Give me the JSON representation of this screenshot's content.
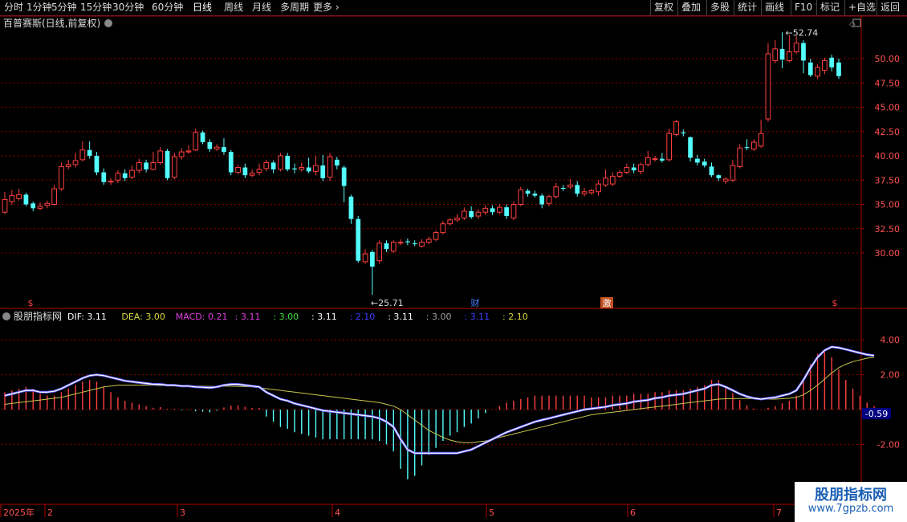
{
  "toolbar": {
    "periods": [
      "分时",
      "1分钟",
      "5分钟",
      "15分钟",
      "30分钟",
      "60分钟",
      "日线",
      "周线",
      "月线",
      "多周期",
      "更多"
    ],
    "active_period": "日线",
    "right_buttons": [
      "复权",
      "叠加",
      "多股",
      "统计",
      "画线",
      "F10",
      "标记",
      "+自选",
      "返回"
    ]
  },
  "colors": {
    "up": "#ff4040",
    "down": "#54ffff",
    "dif": "#ffffff",
    "dea": "#c8c84c",
    "macd_pos": "#ff4040",
    "macd_neg": "#54ffff",
    "axis": "#b00000",
    "grid": "#8b0000"
  },
  "watermark": {
    "title": "股朋指标网",
    "url": "www.7gpzb.com"
  },
  "chart_data": [
    {
      "type": "candlestick",
      "title": "百普赛斯(日线,前复权)",
      "yticks": [
        30.0,
        32.5,
        35.0,
        37.5,
        40.0,
        42.5,
        45.0,
        47.5,
        50.0
      ],
      "ylim": [
        26.8,
        55.0
      ],
      "annotations": {
        "high": "52.74",
        "low": "25.71",
        "events": [
          "$",
          "财",
          "激",
          "$"
        ]
      },
      "x_labels": [
        "2025年",
        "2",
        "3",
        "4",
        "5",
        "6",
        "7"
      ],
      "candles": [
        [
          34.2,
          35.5,
          36.3,
          34.0
        ],
        [
          35.3,
          35.9,
          36.5,
          35.0
        ],
        [
          35.6,
          36.0,
          36.6,
          35.4
        ],
        [
          36.0,
          35.0,
          36.2,
          34.8
        ],
        [
          35.1,
          34.6,
          35.3,
          34.3
        ],
        [
          34.6,
          34.8,
          35.2,
          34.4
        ],
        [
          34.9,
          35.1,
          35.4,
          34.6
        ],
        [
          35.0,
          36.6,
          37.0,
          34.9
        ],
        [
          36.6,
          38.9,
          39.3,
          36.4
        ],
        [
          38.9,
          39.1,
          39.6,
          38.6
        ],
        [
          39.1,
          39.5,
          40.3,
          38.8
        ],
        [
          39.6,
          40.6,
          41.5,
          39.4
        ],
        [
          40.6,
          40.0,
          41.5,
          39.7
        ],
        [
          40.0,
          38.3,
          40.4,
          38.0
        ],
        [
          38.3,
          37.3,
          38.7,
          37.0
        ],
        [
          37.3,
          37.4,
          37.7,
          37.0
        ],
        [
          37.5,
          38.2,
          38.5,
          37.2
        ],
        [
          38.2,
          37.7,
          38.6,
          37.4
        ],
        [
          37.8,
          38.5,
          39.0,
          37.6
        ],
        [
          38.5,
          39.3,
          39.7,
          38.2
        ],
        [
          39.3,
          38.6,
          39.6,
          38.3
        ],
        [
          38.6,
          39.3,
          40.4,
          38.5
        ],
        [
          39.3,
          40.5,
          40.9,
          39.1
        ],
        [
          40.5,
          37.7,
          40.7,
          37.5
        ],
        [
          37.8,
          39.9,
          40.3,
          37.6
        ],
        [
          39.9,
          40.4,
          40.8,
          39.6
        ],
        [
          40.4,
          40.5,
          41.1,
          40.2
        ],
        [
          40.6,
          42.4,
          42.8,
          40.5
        ],
        [
          42.4,
          41.4,
          42.6,
          41.2
        ],
        [
          41.4,
          40.7,
          41.7,
          40.4
        ],
        [
          40.7,
          40.9,
          41.2,
          40.5
        ],
        [
          40.9,
          40.4,
          41.8,
          40.1
        ],
        [
          40.4,
          38.3,
          40.6,
          38.0
        ],
        [
          38.3,
          38.8,
          39.1,
          38.1
        ],
        [
          38.8,
          38.0,
          39.2,
          37.7
        ],
        [
          38.0,
          38.2,
          38.6,
          37.8
        ],
        [
          38.3,
          38.6,
          39.2,
          38.0
        ],
        [
          38.7,
          39.3,
          39.6,
          38.4
        ],
        [
          39.3,
          38.6,
          39.5,
          38.2
        ],
        [
          38.6,
          40.0,
          40.3,
          38.4
        ],
        [
          40.0,
          38.6,
          40.3,
          38.4
        ],
        [
          38.7,
          38.6,
          39.2,
          38.2
        ],
        [
          38.6,
          38.8,
          39.3,
          38.4
        ],
        [
          38.8,
          38.4,
          39.8,
          38.2
        ],
        [
          38.4,
          39.0,
          40.0,
          38.0
        ],
        [
          39.0,
          37.7,
          40.1,
          37.4
        ],
        [
          37.8,
          39.9,
          40.3,
          37.4
        ],
        [
          39.6,
          39.0,
          39.9,
          38.6
        ],
        [
          38.8,
          36.9,
          39.0,
          35.2
        ],
        [
          35.8,
          33.5,
          36.0,
          33.0
        ],
        [
          33.5,
          29.2,
          33.8,
          29.0
        ],
        [
          29.1,
          29.9,
          30.4,
          28.9
        ],
        [
          30.1,
          28.6,
          30.3,
          25.7
        ],
        [
          29.2,
          31.0,
          31.3,
          28.9
        ],
        [
          31.0,
          30.4,
          31.3,
          30.1
        ],
        [
          30.2,
          31.1,
          31.3,
          30.0
        ],
        [
          31.1,
          31.1,
          31.4,
          30.8
        ],
        [
          31.2,
          31.1,
          31.5,
          30.8
        ],
        [
          31.0,
          30.9,
          31.3,
          30.7
        ],
        [
          30.7,
          31.1,
          31.4,
          30.6
        ],
        [
          31.1,
          31.4,
          31.7,
          30.9
        ],
        [
          31.4,
          32.1,
          32.3,
          31.2
        ],
        [
          32.1,
          33.0,
          33.3,
          31.9
        ],
        [
          33.0,
          33.4,
          33.6,
          32.8
        ],
        [
          33.4,
          33.6,
          34.0,
          33.2
        ],
        [
          33.6,
          34.3,
          34.7,
          33.4
        ],
        [
          34.3,
          33.7,
          34.8,
          33.5
        ],
        [
          33.8,
          34.2,
          34.5,
          33.5
        ],
        [
          34.2,
          34.6,
          34.9,
          33.9
        ],
        [
          34.6,
          34.2,
          34.9,
          33.9
        ],
        [
          34.2,
          34.7,
          35.0,
          34.0
        ],
        [
          34.7,
          33.8,
          35.0,
          33.5
        ],
        [
          33.6,
          35.0,
          35.3,
          33.4
        ],
        [
          35.0,
          36.5,
          36.8,
          34.8
        ],
        [
          36.4,
          36.1,
          36.6,
          35.8
        ],
        [
          36.1,
          35.9,
          36.4,
          35.7
        ],
        [
          35.9,
          35.0,
          36.1,
          34.6
        ],
        [
          35.1,
          35.8,
          36.0,
          34.8
        ],
        [
          35.8,
          36.8,
          37.2,
          35.6
        ],
        [
          36.7,
          36.6,
          37.0,
          36.4
        ],
        [
          36.8,
          37.0,
          37.6,
          36.6
        ],
        [
          37.0,
          36.1,
          37.4,
          35.8
        ],
        [
          36.1,
          36.3,
          36.7,
          35.8
        ],
        [
          36.2,
          36.4,
          36.6,
          36.0
        ],
        [
          36.3,
          37.1,
          37.5,
          35.9
        ],
        [
          37.0,
          37.7,
          38.6,
          36.8
        ],
        [
          37.1,
          37.9,
          38.3,
          36.9
        ],
        [
          37.9,
          38.3,
          38.5,
          37.7
        ],
        [
          38.3,
          38.8,
          39.2,
          38.1
        ],
        [
          38.8,
          38.5,
          39.2,
          38.2
        ],
        [
          38.4,
          39.1,
          39.3,
          38.1
        ],
        [
          39.1,
          39.8,
          40.5,
          38.9
        ],
        [
          39.7,
          39.7,
          40.0,
          39.4
        ],
        [
          39.7,
          39.5,
          40.3,
          39.3
        ],
        [
          39.6,
          42.3,
          42.8,
          39.4
        ],
        [
          42.2,
          43.5,
          43.7,
          42.0
        ],
        [
          42.4,
          42.3,
          42.7,
          42.0
        ],
        [
          41.9,
          39.8,
          42.0,
          39.4
        ],
        [
          39.7,
          39.3,
          40.1,
          39.0
        ],
        [
          39.4,
          39.0,
          39.7,
          38.8
        ],
        [
          38.9,
          38.0,
          39.3,
          37.8
        ],
        [
          38.0,
          37.7,
          38.1,
          37.4
        ],
        [
          37.4,
          37.6,
          37.8,
          37.1
        ],
        [
          37.5,
          39.0,
          39.6,
          37.3
        ],
        [
          38.9,
          40.8,
          41.2,
          38.7
        ],
        [
          40.9,
          40.8,
          41.7,
          40.6
        ],
        [
          40.7,
          41.4,
          41.7,
          40.5
        ],
        [
          41.0,
          42.3,
          43.7,
          40.8
        ],
        [
          43.8,
          50.5,
          51.6,
          43.5
        ],
        [
          49.8,
          51.0,
          51.9,
          49.5
        ],
        [
          51.0,
          49.9,
          52.7,
          49.0
        ],
        [
          49.8,
          50.7,
          52.4,
          49.6
        ],
        [
          50.7,
          51.6,
          52.3,
          50.5
        ],
        [
          51.6,
          49.8,
          51.9,
          48.5
        ],
        [
          49.6,
          48.3,
          50.0,
          48.1
        ],
        [
          48.2,
          49.1,
          49.4,
          47.9
        ],
        [
          48.8,
          49.8,
          50.1,
          48.4
        ],
        [
          50.1,
          49.1,
          50.4,
          48.7
        ],
        [
          49.6,
          48.2,
          50.0,
          47.9
        ]
      ]
    },
    {
      "type": "line+bar",
      "title": "股朋指标网",
      "legend": [
        {
          "label": "DIF: 3.11",
          "color": "#ffffff"
        },
        {
          "label": "DEA: 3.00",
          "color": "#d8d83c"
        },
        {
          "label": "MACD: 0.21",
          "color": "#e040e0"
        },
        {
          "label": ": 3.11",
          "color": "#e040e0"
        },
        {
          "label": ": 3.00",
          "color": "#40e040"
        },
        {
          "label": ": 3.11",
          "color": "#ffffff"
        },
        {
          "label": ": 2.10",
          "color": "#4040ff"
        },
        {
          "label": ": 3.11",
          "color": "#ffffff"
        },
        {
          "label": ": 3.00",
          "color": "#a0a0a0"
        },
        {
          "label": ": 3.11",
          "color": "#4040ff"
        },
        {
          "label": ": 2.10",
          "color": "#d8d83c"
        }
      ],
      "yticks": [
        4.0,
        2.0,
        -2.0
      ],
      "ylim": [
        -5.5,
        5.5
      ],
      "current_value": "0.59",
      "dif": [
        0.8,
        0.9,
        1.0,
        1.1,
        1.1,
        1.0,
        1.0,
        1.05,
        1.2,
        1.4,
        1.6,
        1.8,
        1.95,
        2.0,
        1.95,
        1.85,
        1.75,
        1.65,
        1.6,
        1.55,
        1.5,
        1.45,
        1.45,
        1.4,
        1.4,
        1.35,
        1.35,
        1.3,
        1.28,
        1.25,
        1.3,
        1.4,
        1.45,
        1.45,
        1.4,
        1.35,
        1.3,
        1.0,
        0.8,
        0.6,
        0.5,
        0.35,
        0.25,
        0.15,
        0.05,
        -0.05,
        -0.1,
        -0.15,
        -0.2,
        -0.25,
        -0.3,
        -0.35,
        -0.4,
        -0.5,
        -0.7,
        -1.0,
        -1.7,
        -2.3,
        -2.5,
        -2.5,
        -2.5,
        -2.5,
        -2.5,
        -2.5,
        -2.5,
        -2.4,
        -2.3,
        -2.1,
        -1.9,
        -1.7,
        -1.5,
        -1.3,
        -1.15,
        -1.0,
        -0.85,
        -0.7,
        -0.6,
        -0.5,
        -0.4,
        -0.3,
        -0.2,
        -0.1,
        0.0,
        0.05,
        0.1,
        0.15,
        0.25,
        0.3,
        0.35,
        0.45,
        0.5,
        0.55,
        0.65,
        0.7,
        0.8,
        0.85,
        0.9,
        1.0,
        1.1,
        1.2,
        1.4,
        1.45,
        1.3,
        1.1,
        0.9,
        0.75,
        0.65,
        0.6,
        0.65,
        0.7,
        0.8,
        0.9,
        1.1,
        1.7,
        2.4,
        3.0,
        3.4,
        3.6,
        3.55,
        3.45,
        3.35,
        3.25,
        3.15,
        3.1
      ],
      "dea": [
        0.3,
        0.35,
        0.4,
        0.45,
        0.5,
        0.55,
        0.6,
        0.65,
        0.7,
        0.8,
        0.9,
        1.0,
        1.1,
        1.2,
        1.3,
        1.35,
        1.4,
        1.4,
        1.4,
        1.4,
        1.4,
        1.4,
        1.38,
        1.38,
        1.38,
        1.37,
        1.36,
        1.35,
        1.34,
        1.33,
        1.33,
        1.34,
        1.34,
        1.33,
        1.32,
        1.3,
        1.25,
        1.2,
        1.15,
        1.1,
        1.05,
        1.0,
        0.95,
        0.9,
        0.85,
        0.8,
        0.75,
        0.7,
        0.65,
        0.6,
        0.55,
        0.5,
        0.45,
        0.4,
        0.3,
        0.2,
        0.0,
        -0.3,
        -0.6,
        -0.9,
        -1.2,
        -1.4,
        -1.6,
        -1.75,
        -1.85,
        -1.9,
        -1.9,
        -1.85,
        -1.8,
        -1.7,
        -1.6,
        -1.5,
        -1.4,
        -1.3,
        -1.2,
        -1.1,
        -1.0,
        -0.9,
        -0.8,
        -0.7,
        -0.6,
        -0.5,
        -0.4,
        -0.3,
        -0.25,
        -0.2,
        -0.15,
        -0.1,
        -0.05,
        0.0,
        0.05,
        0.1,
        0.15,
        0.2,
        0.25,
        0.3,
        0.35,
        0.4,
        0.45,
        0.5,
        0.55,
        0.6,
        0.62,
        0.63,
        0.63,
        0.63,
        0.62,
        0.6,
        0.6,
        0.6,
        0.62,
        0.65,
        0.7,
        0.85,
        1.1,
        1.4,
        1.75,
        2.1,
        2.4,
        2.6,
        2.75,
        2.85,
        2.95,
        3.0
      ]
    }
  ]
}
